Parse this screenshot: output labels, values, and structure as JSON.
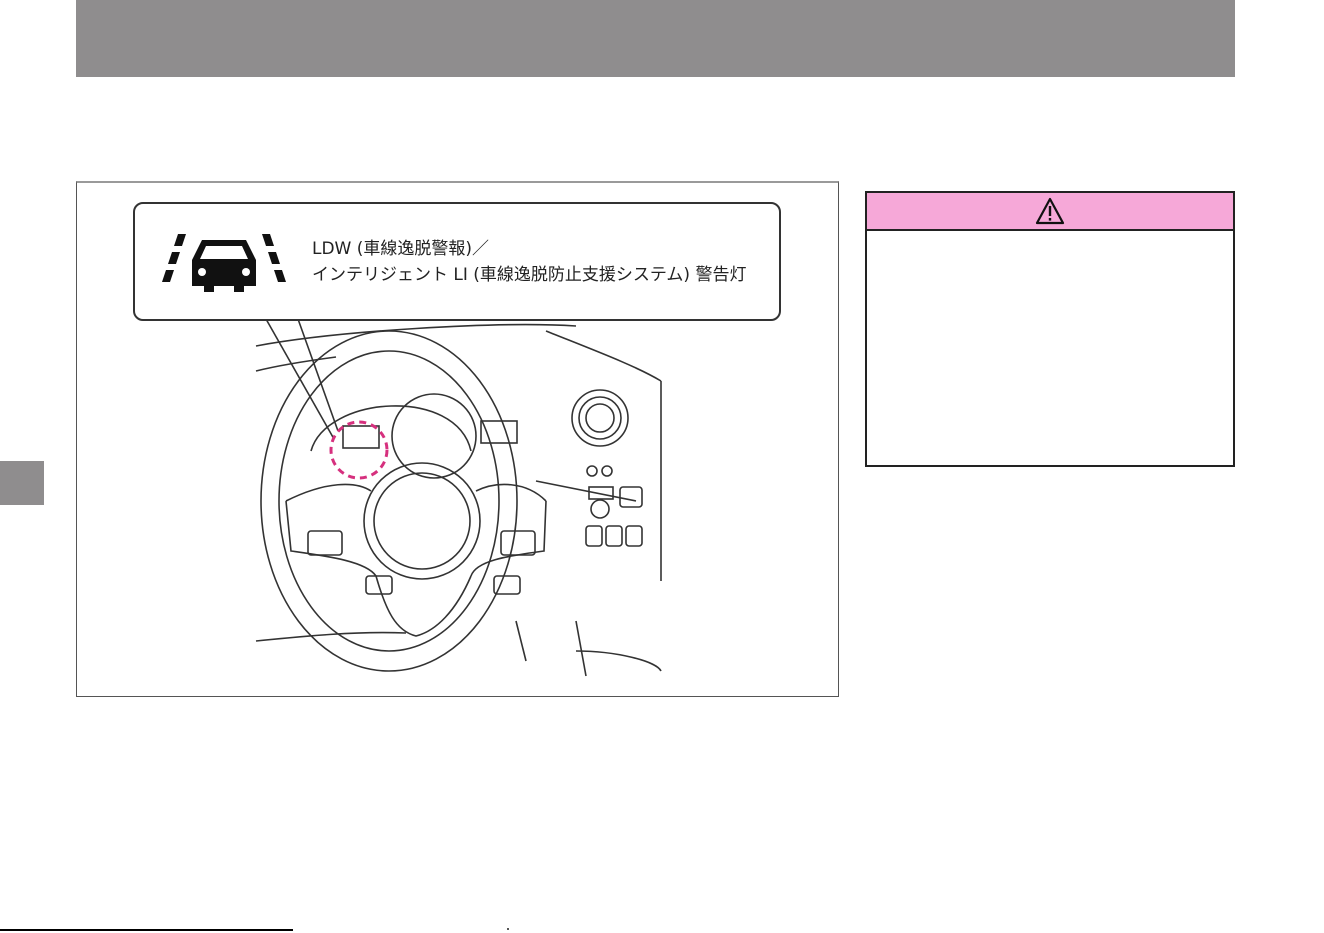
{
  "callout": {
    "line1": "LDW (車線逸脱警報)／",
    "line2": "インテリジェント LI (車線逸脱防止支援システム) 警告灯"
  },
  "icons": {
    "lane_warning": "lane-departure-car-icon",
    "warning": "warning-triangle-icon"
  },
  "colors": {
    "header_bar": "#8f8d8e",
    "warning_header": "#f6a8d8",
    "highlight_circle": "#d6307e"
  }
}
